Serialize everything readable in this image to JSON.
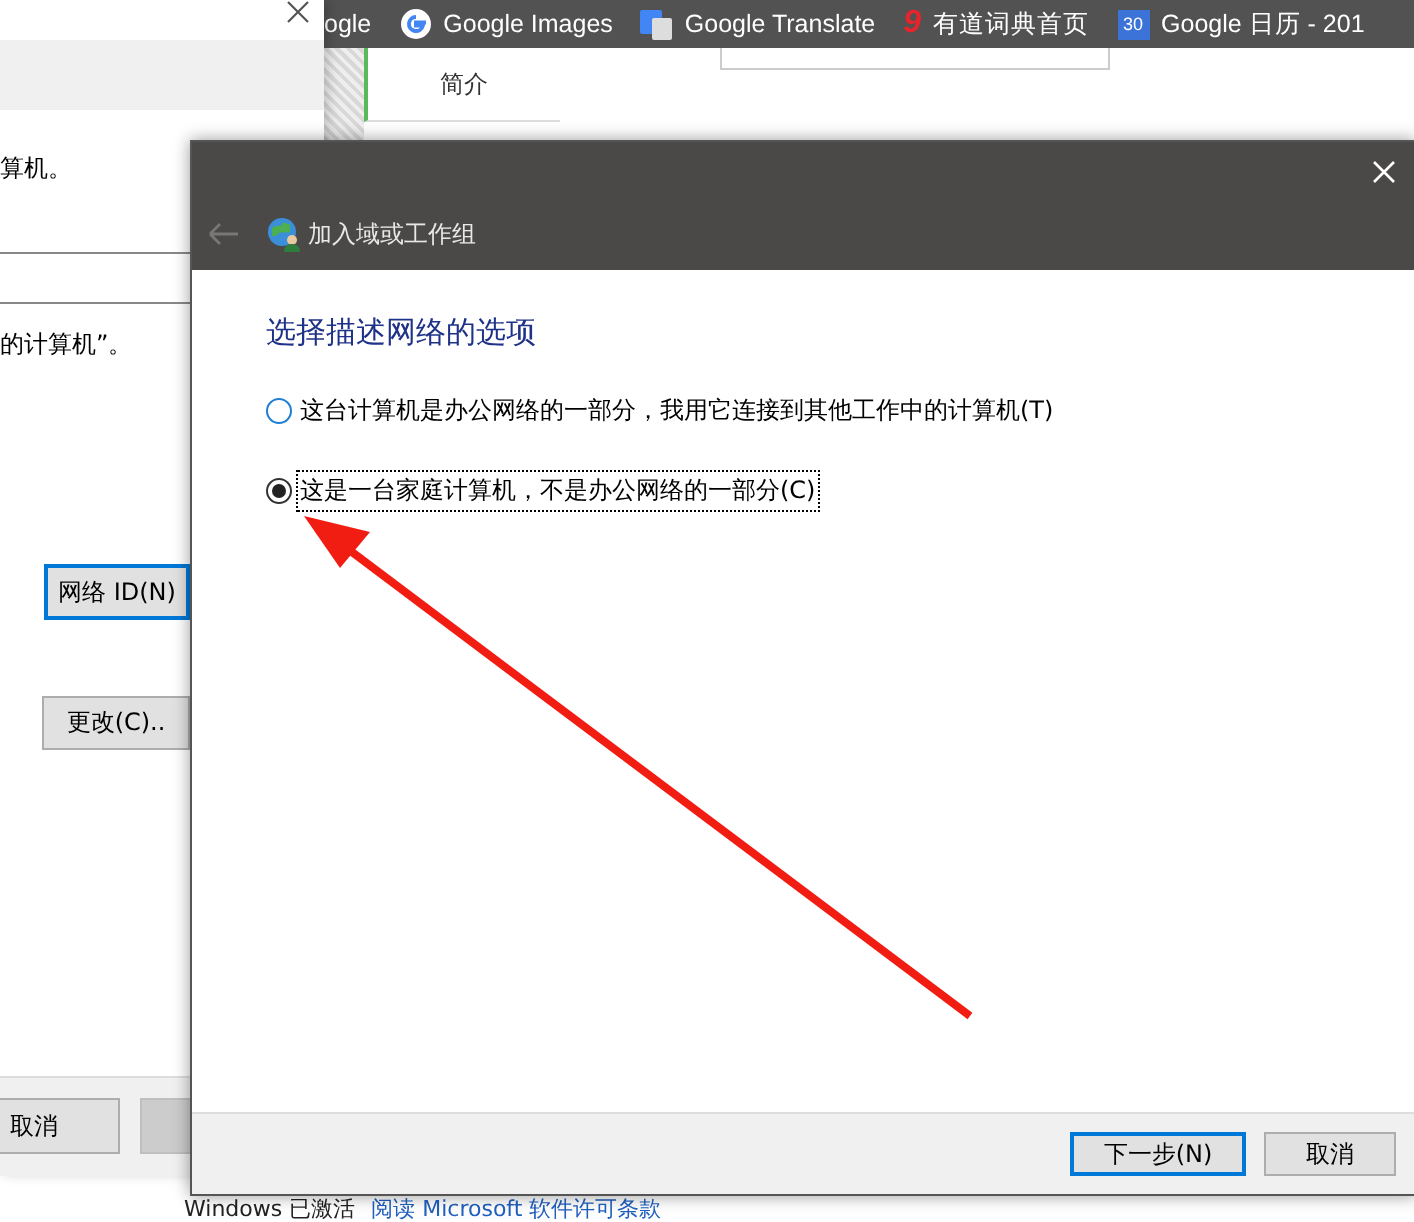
{
  "browser": {
    "bookmarks": [
      {
        "kind": "text",
        "label": "ogle"
      },
      {
        "kind": "google",
        "label": "Google Images"
      },
      {
        "kind": "translate",
        "label": "Google Translate"
      },
      {
        "kind": "youdao",
        "icon_text": "9",
        "label": "有道词典首页"
      },
      {
        "kind": "calendar",
        "icon_text": "30",
        "label": "Google 日历 - 201"
      }
    ],
    "page_tab": {
      "label": "简介",
      "selected": true
    }
  },
  "back_window": {
    "texts": [
      "算机。",
      "的计算机”。"
    ],
    "buttons": [
      {
        "label": "网络 ID(N)",
        "focused": true
      },
      {
        "label": "更改(C)..",
        "focused": false
      }
    ],
    "footer_buttons": [
      {
        "label": "取消",
        "disabled": false
      },
      {
        "disabled": true
      }
    ]
  },
  "activation": {
    "status": "Windows 已激活",
    "link": "阅读 Microsoft 软件许可条款"
  },
  "dialog": {
    "title": "加入域或工作组",
    "back_disabled": true,
    "heading": "选择描述网络的选项",
    "options": [
      {
        "label": "这台计算机是办公网络的一部分，我用它连接到其他工作中的计算机(T)",
        "selected": false
      },
      {
        "label": "这是一台家庭计算机，不是办公网络的一部分(C)",
        "selected": true
      }
    ],
    "buttons": [
      {
        "label": "下一步(N)",
        "default": true
      },
      {
        "label": "取消",
        "default": false
      }
    ]
  }
}
